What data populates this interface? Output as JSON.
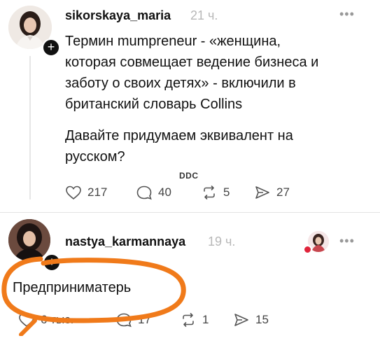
{
  "post1": {
    "username": "sikorskaya_maria",
    "time": "21 ч.",
    "menu": "•••",
    "text_lines": [
      "Термин mumpreneur - «женщина,",
      "которая совмещает ведение бизнеса и",
      "заботу о своих детях» - включили в",
      "британский словарь Collins"
    ],
    "text2_lines": [
      "Давайте придумаем эквивалент на",
      "русском?"
    ],
    "actions": {
      "likes": "217",
      "comments": "40",
      "reposts": "5",
      "shares": "27"
    }
  },
  "watermark": "DDC",
  "post2": {
    "username": "nastya_karmannaya",
    "time": "19 ч.",
    "menu": "•••",
    "text": "Предприниматерь",
    "actions": {
      "likes": "6 тыс.",
      "comments": "17",
      "reposts": "1",
      "shares": "15"
    }
  },
  "colors": {
    "highlight": "#f07a1a",
    "text": "#111111",
    "muted": "#b8b8b8"
  }
}
